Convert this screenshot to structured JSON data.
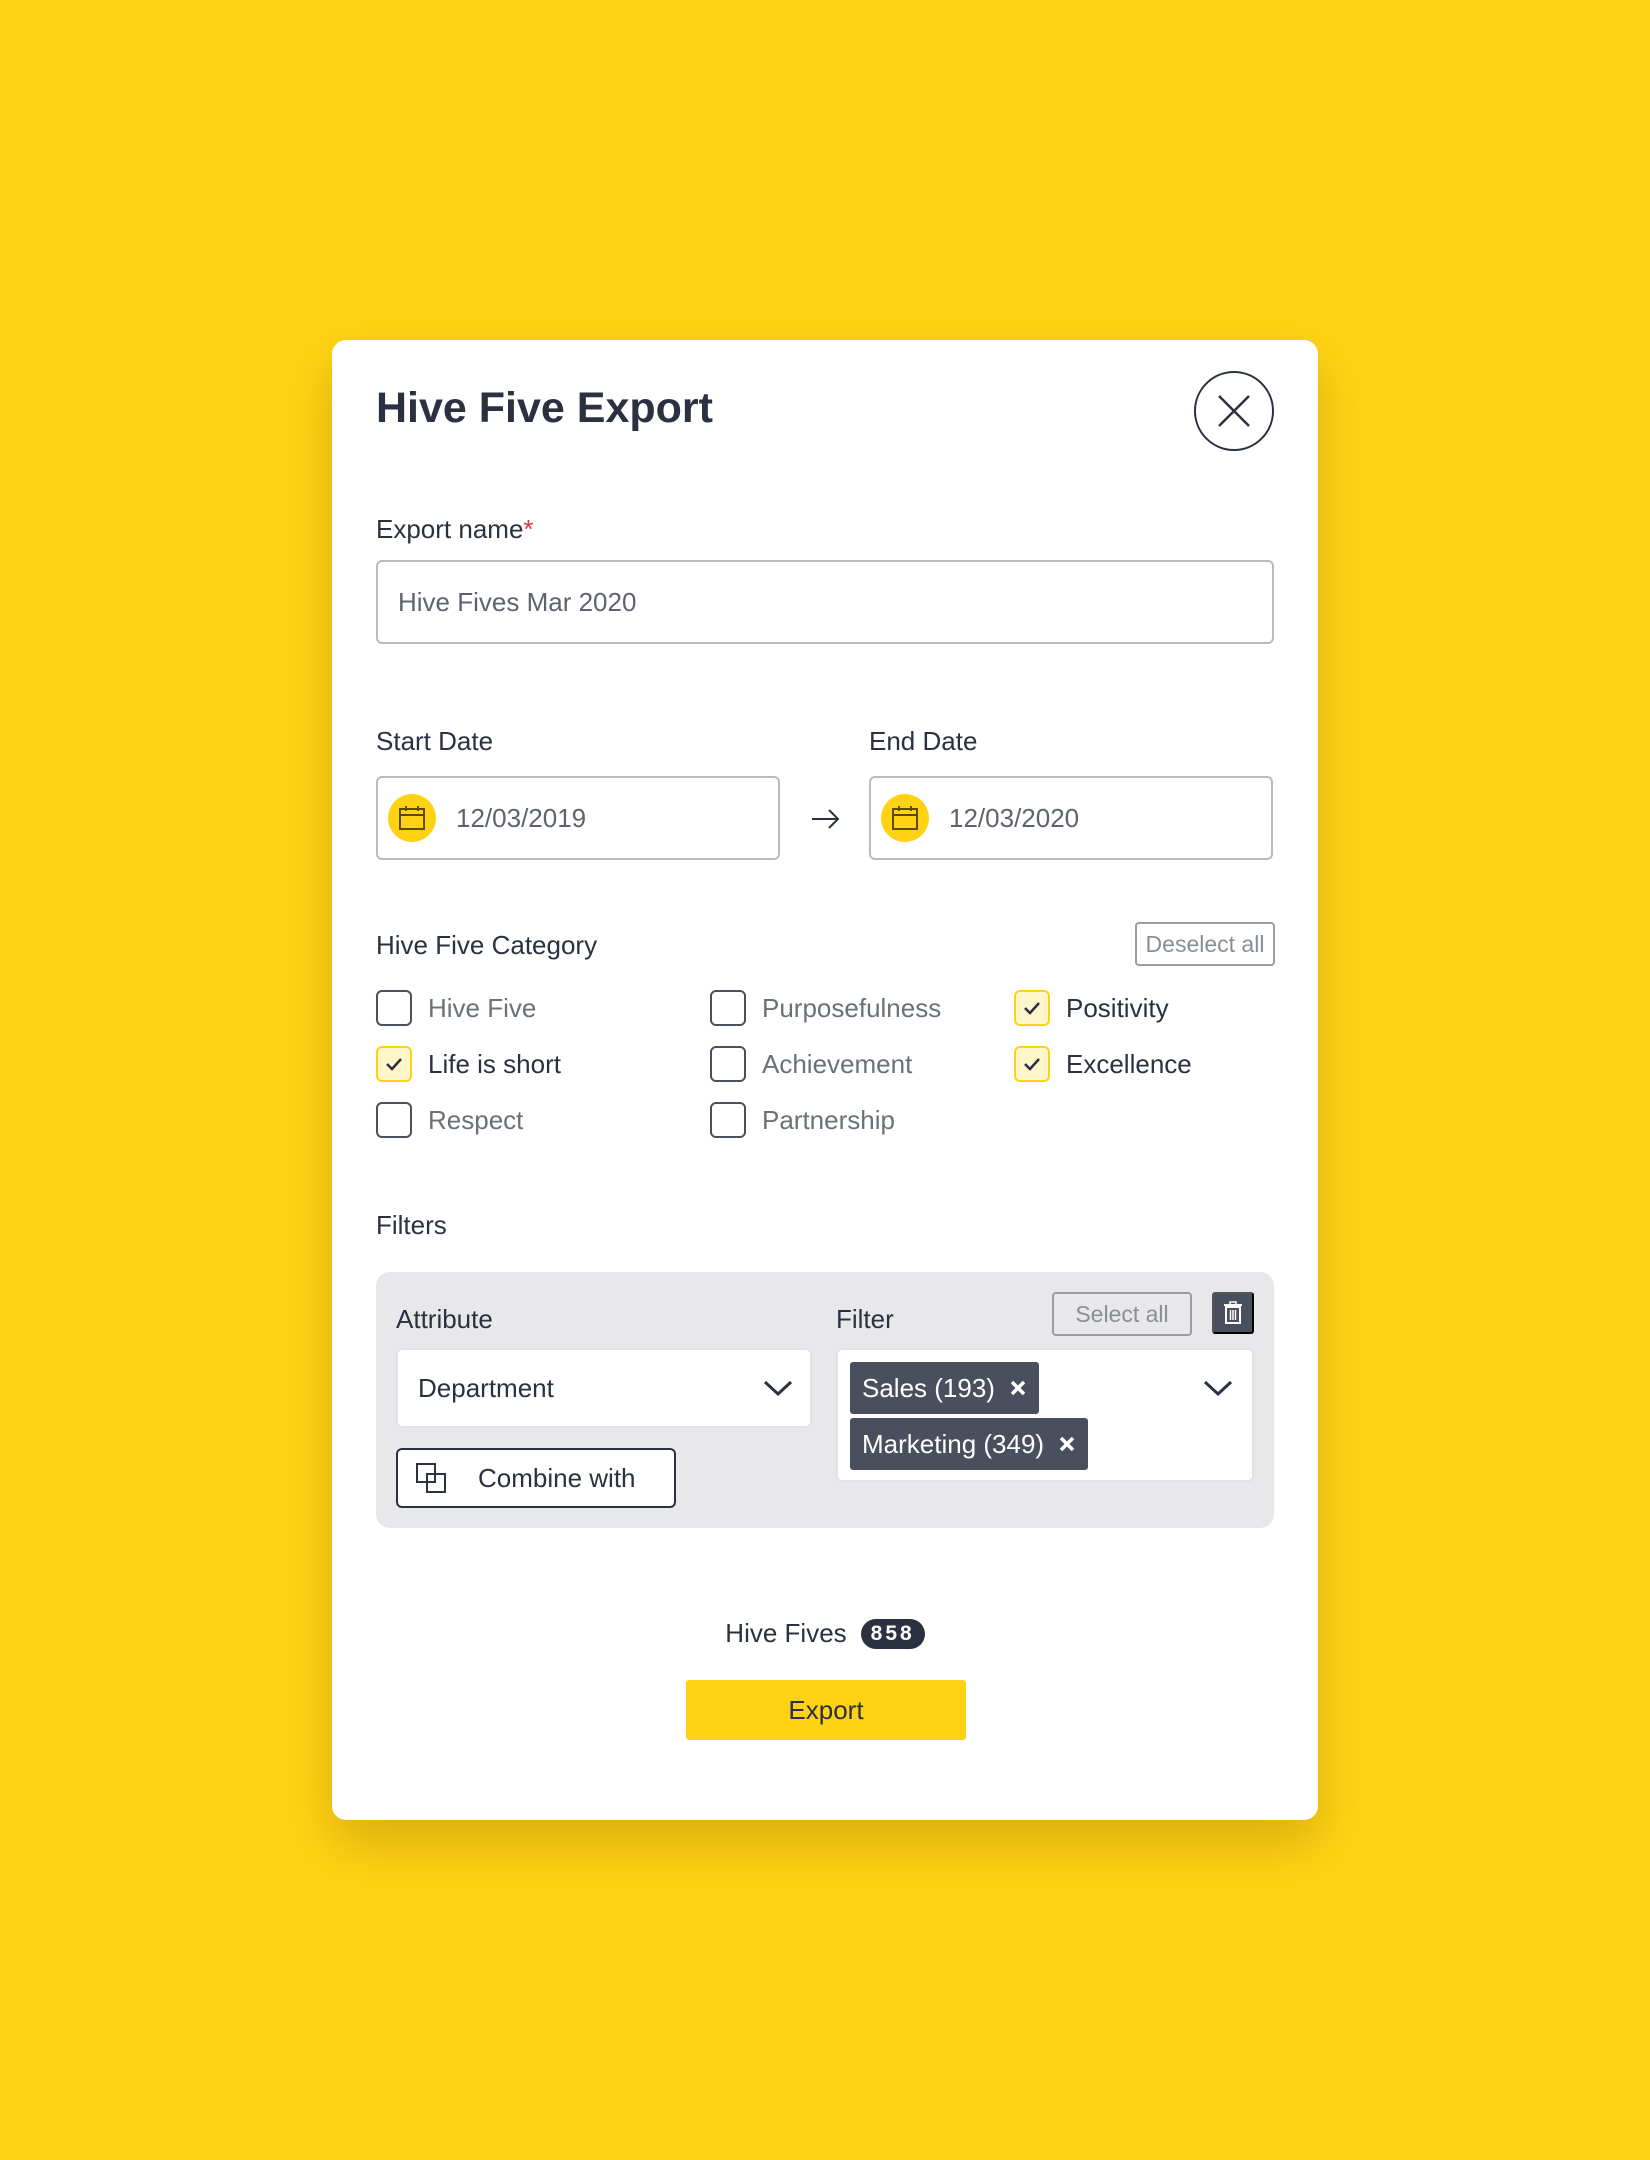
{
  "modal": {
    "title": "Hive Five Export",
    "close_icon": "close-icon"
  },
  "export_name": {
    "label": "Export name",
    "required_marker": "*",
    "value": "Hive Fives Mar 2020"
  },
  "dates": {
    "start_label": "Start Date",
    "start_value": "12/03/2019",
    "end_label": "End Date",
    "end_value": "12/03/2020",
    "calendar_icon": "calendar-icon",
    "arrow_icon": "arrow-right-icon"
  },
  "category": {
    "label": "Hive Five Category",
    "deselect_all": "Deselect all",
    "items": [
      {
        "label": "Hive Five",
        "checked": false
      },
      {
        "label": "Life is short",
        "checked": true
      },
      {
        "label": "Respect",
        "checked": false
      },
      {
        "label": "Purposefulness",
        "checked": false
      },
      {
        "label": "Achievement",
        "checked": false
      },
      {
        "label": "Partnership",
        "checked": false
      },
      {
        "label": "Positivity",
        "checked": true
      },
      {
        "label": "Excellence",
        "checked": true
      }
    ]
  },
  "filters": {
    "label": "Filters",
    "attribute_label": "Attribute",
    "attribute_value": "Department",
    "filter_label": "Filter",
    "select_all": "Select all",
    "combine_with": "Combine with",
    "chips": [
      "Sales (193)",
      "Marketing (349)"
    ]
  },
  "summary": {
    "label": "Hive Fives",
    "count": "858"
  },
  "export_button": "Export",
  "colors": {
    "background": "#FFD313",
    "text": "#2B3140",
    "chip": "#4A4F5E",
    "required": "#E0303C"
  }
}
